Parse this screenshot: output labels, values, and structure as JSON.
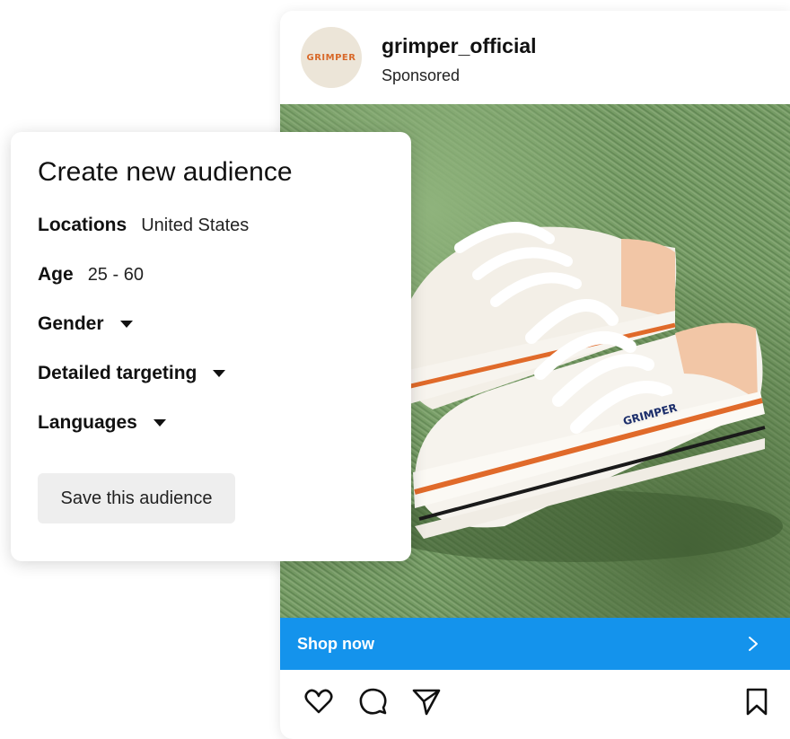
{
  "post": {
    "avatar_text": "GRIMPER",
    "username": "grimper_official",
    "sponsored_label": "Sponsored",
    "cta_label": "Shop now",
    "image_alt": "White platform canvas sneakers on grass",
    "shoe_label": "GRIMPER",
    "icons": {
      "like": "heart-icon",
      "comment": "comment-icon",
      "share": "send-icon",
      "save": "bookmark-icon",
      "cta": "chevron-right-icon"
    }
  },
  "audience": {
    "title": "Create new audience",
    "location_label": "Locations",
    "location_value": "United States",
    "age_label": "Age",
    "age_value": "25 - 60",
    "gender_label": "Gender",
    "targeting_label": "Detailed targeting",
    "languages_label": "Languages",
    "save_label": "Save this audience"
  },
  "colors": {
    "cta": "#1493ec",
    "avatar_bg": "#ece5d8",
    "avatar_text": "#d8692a",
    "button_bg": "#eeeeee"
  }
}
